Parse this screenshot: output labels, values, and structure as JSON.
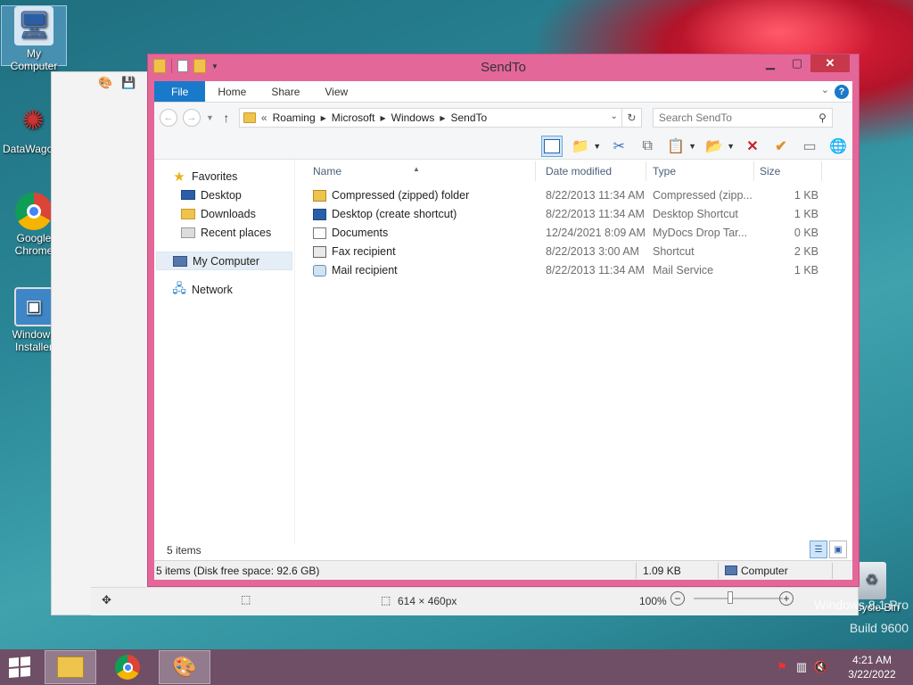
{
  "desktop": {
    "icons": [
      {
        "label": "My Computer"
      },
      {
        "label": "DataWago"
      },
      {
        "label": "Google Chrome"
      },
      {
        "label": "Windows Installer"
      },
      {
        "label": "Recycle Bin"
      }
    ],
    "watermark_line1": "Windows 8.1 Pro",
    "watermark_line2": "Build 9600"
  },
  "paint": {
    "size_text": "614 × 460px",
    "zoom": "100%",
    "zoom_minus": "−",
    "zoom_plus": "+"
  },
  "explorer": {
    "title": "SendTo",
    "tabs": [
      {
        "label": "File"
      },
      {
        "label": "Home"
      },
      {
        "label": "Share"
      },
      {
        "label": "View"
      }
    ],
    "address": {
      "prefix": "«",
      "crumbs": [
        "Roaming",
        "Microsoft",
        "Windows",
        "SendTo"
      ]
    },
    "search_placeholder": "Search SendTo",
    "nav": {
      "favorites": "Favorites",
      "desktop": "Desktop",
      "downloads": "Downloads",
      "recent": "Recent places",
      "computer": "My Computer",
      "network": "Network"
    },
    "columns": {
      "name": "Name",
      "date": "Date modified",
      "type": "Type",
      "size": "Size"
    },
    "files": [
      {
        "name": "Compressed (zipped) folder",
        "date": "8/22/2013 11:34 AM",
        "type": "Compressed (zipp...",
        "size": "1 KB",
        "icon": "zip"
      },
      {
        "name": "Desktop (create shortcut)",
        "date": "8/22/2013 11:34 AM",
        "type": "Desktop Shortcut",
        "size": "1 KB",
        "icon": "desk"
      },
      {
        "name": "Documents",
        "date": "12/24/2021 8:09 AM",
        "type": "MyDocs Drop Tar...",
        "size": "0 KB",
        "icon": "doc"
      },
      {
        "name": "Fax recipient",
        "date": "8/22/2013 3:00 AM",
        "type": "Shortcut",
        "size": "2 KB",
        "icon": "fax"
      },
      {
        "name": "Mail recipient",
        "date": "8/22/2013 11:34 AM",
        "type": "Mail Service",
        "size": "1 KB",
        "icon": "mail"
      }
    ],
    "item_count": "5 items",
    "status": {
      "left": "5 items (Disk free space: 92.6 GB)",
      "size": "1.09 KB",
      "location": "Computer"
    }
  },
  "taskbar": {
    "time": "4:21 AM",
    "date": "3/22/2022"
  }
}
